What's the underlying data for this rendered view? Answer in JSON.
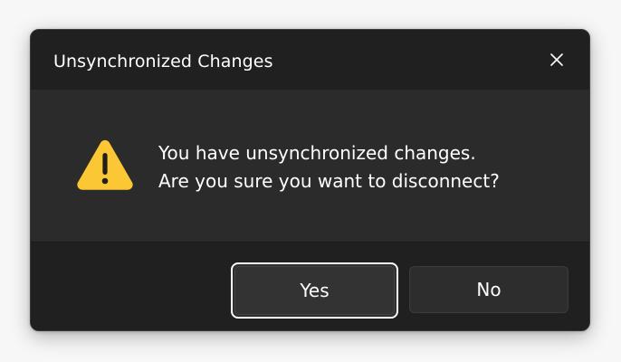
{
  "dialog": {
    "title": "Unsynchronized Changes",
    "message_line1": "You have unsynchronized changes.",
    "message_line2": "Are you sure you want to disconnect?",
    "icon": "warning-triangle-icon",
    "close_icon": "close-icon",
    "buttons": {
      "yes_label": "Yes",
      "no_label": "No"
    }
  },
  "colors": {
    "warning": "#fcc734",
    "titlebar_bg": "#202020",
    "content_bg": "#2b2b2b",
    "focus_ring": "#ffffff"
  }
}
